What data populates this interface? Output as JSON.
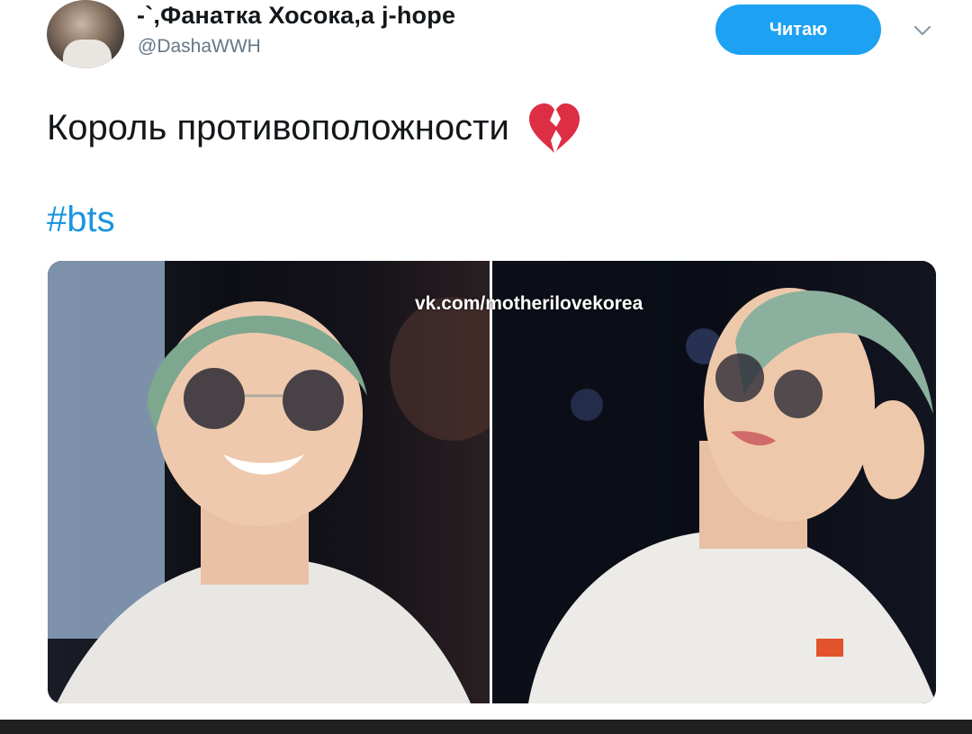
{
  "tweet": {
    "display_name": "-`,Фанатка Хосока,а j-hope",
    "handle": "@DashaWWH",
    "follow_button_label": "Читаю",
    "text": "Король противоположности",
    "emoji": "broken-heart",
    "hashtag": "#bts"
  },
  "media": {
    "watermark": "vk.com/motherilovekorea",
    "images": [
      {
        "description_icon": "photo-left"
      },
      {
        "description_icon": "photo-right"
      }
    ]
  },
  "colors": {
    "accent": "#1da1f2",
    "hashtag": "#1b95e0",
    "secondary_text": "#657786",
    "primary_text": "#14171a"
  }
}
